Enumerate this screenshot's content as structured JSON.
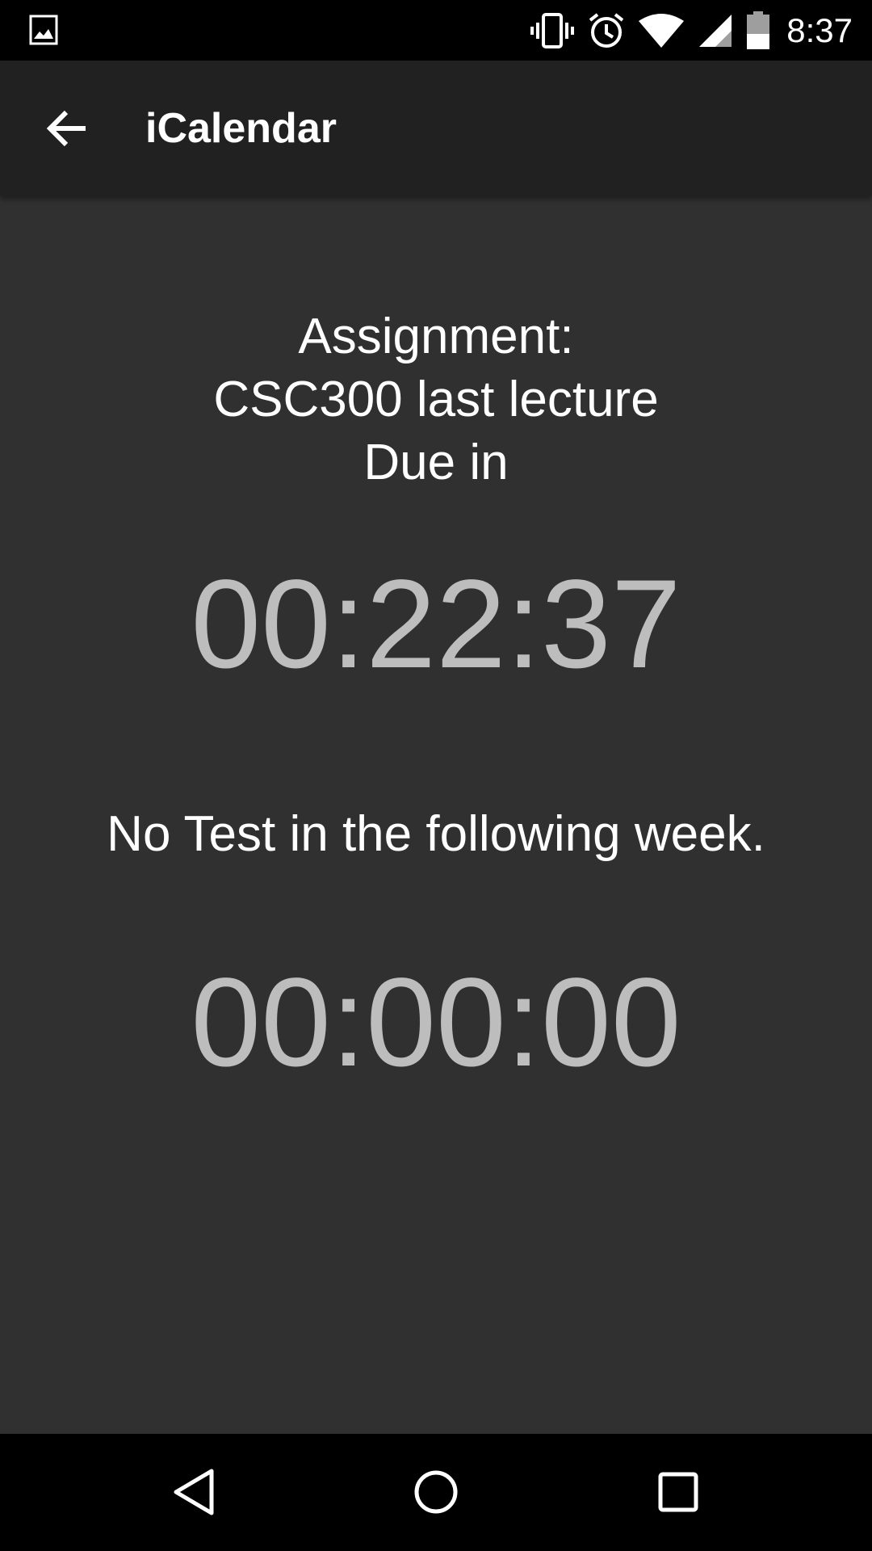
{
  "status_bar": {
    "time": "8:37",
    "icons": [
      "image-notification-icon",
      "vibrate-icon",
      "alarm-icon",
      "wifi-icon",
      "cell-signal-icon",
      "battery-icon"
    ]
  },
  "app_bar": {
    "title": "iCalendar",
    "back_icon": "arrow-back-icon"
  },
  "assignment": {
    "label": "Assignment:",
    "name": "CSC300 last lecture",
    "due_label": "Due in",
    "countdown": "00:22:37"
  },
  "test": {
    "message": "No Test in the following week.",
    "countdown": "00:00:00"
  },
  "nav_bar": {
    "icons": [
      "nav-back-icon",
      "nav-home-icon",
      "nav-recents-icon"
    ]
  },
  "colors": {
    "background": "#303030",
    "app_bar": "#212121",
    "status_bar": "#000000",
    "countdown_text": "#bdbdbd",
    "primary_text": "#ffffff"
  }
}
